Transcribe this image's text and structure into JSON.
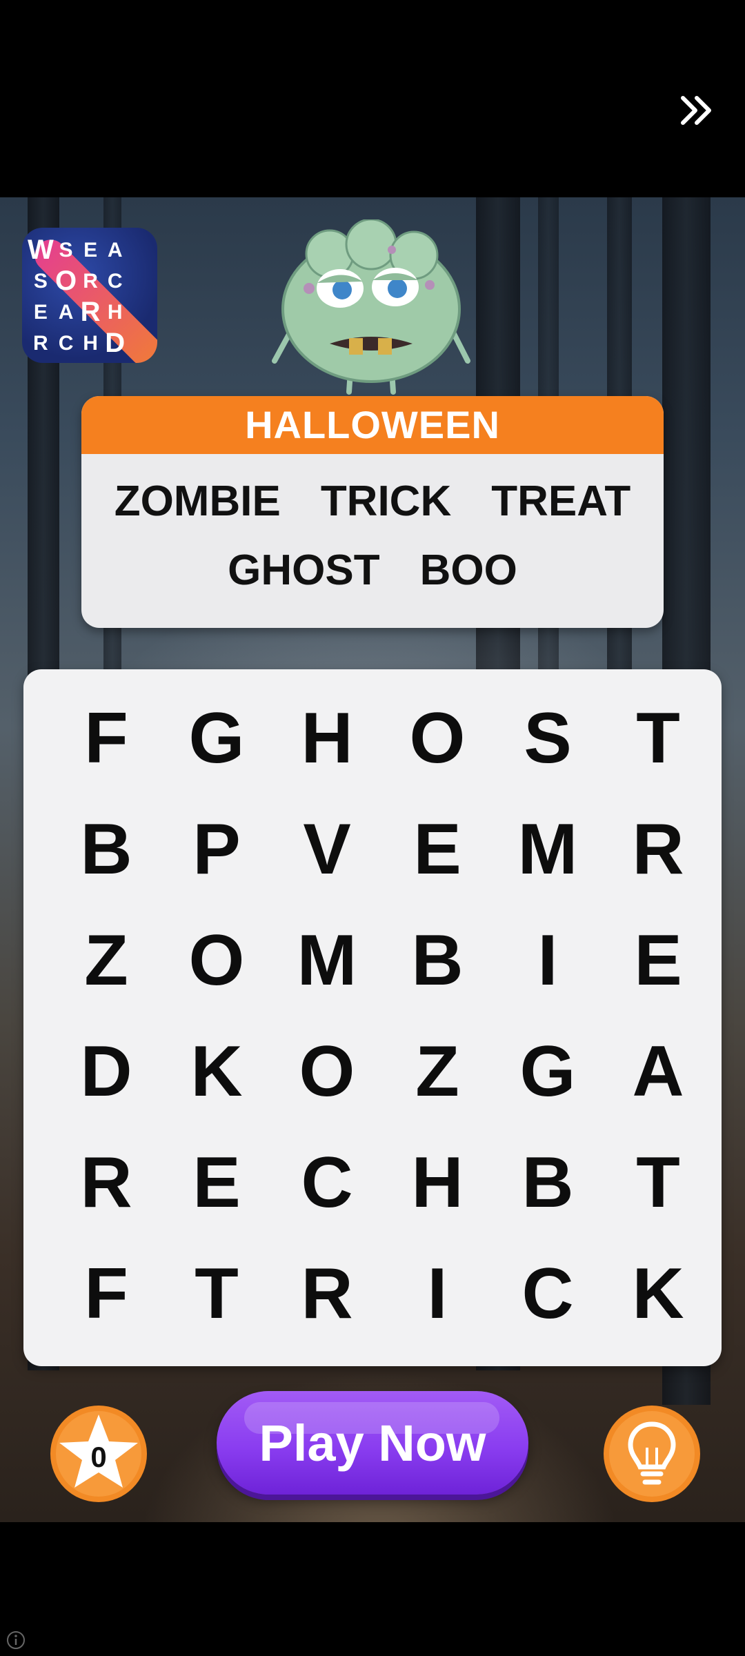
{
  "theme": {
    "title": "HALLOWEEN"
  },
  "words": [
    [
      "ZOMBIE",
      "TRICK",
      "TREAT"
    ],
    [
      "GHOST",
      "BOO"
    ]
  ],
  "grid": [
    [
      "F",
      "G",
      "H",
      "O",
      "S",
      "T"
    ],
    [
      "B",
      "P",
      "V",
      "E",
      "M",
      "R"
    ],
    [
      "Z",
      "O",
      "M",
      "B",
      "I",
      "E"
    ],
    [
      "D",
      "K",
      "O",
      "Z",
      "G",
      "A"
    ],
    [
      "R",
      "E",
      "C",
      "H",
      "B",
      "T"
    ],
    [
      "F",
      "T",
      "R",
      "I",
      "C",
      "K"
    ]
  ],
  "logo": {
    "letters": [
      "W",
      "S",
      "E",
      "A",
      "",
      "S",
      "O",
      "R",
      "C",
      "",
      "E",
      "A",
      "R",
      "H",
      "",
      "R",
      "C",
      "H",
      "D",
      ""
    ]
  },
  "footer": {
    "star_count": "0",
    "play_label": "Play Now"
  },
  "icons": {
    "skip": "double-chevron-right-icon",
    "star": "star-icon",
    "hint": "lightbulb-icon",
    "info": "info-icon"
  },
  "colors": {
    "accent": "#f5801f",
    "play": "#8a3df0"
  }
}
